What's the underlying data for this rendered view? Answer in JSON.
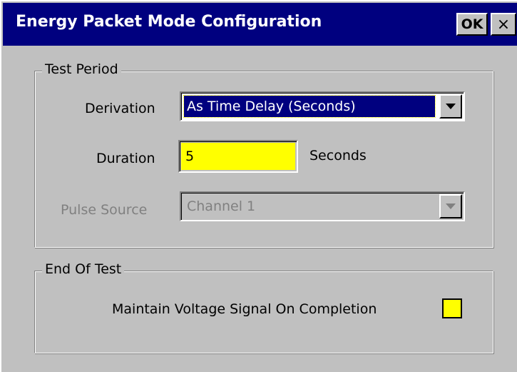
{
  "window": {
    "title": "Energy Packet Mode Configuration",
    "ok_label": "OK",
    "close_label": "×"
  },
  "test_period": {
    "legend": "Test Period",
    "derivation": {
      "label": "Derivation",
      "value": "As Time Delay (Seconds)"
    },
    "duration": {
      "label": "Duration",
      "value": "5",
      "unit": "Seconds"
    },
    "pulse_source": {
      "label": "Pulse Source",
      "value": "Channel 1",
      "enabled": false
    }
  },
  "end_of_test": {
    "legend": "End Of Test",
    "maintain_voltage": {
      "label": "Maintain Voltage Signal On Completion",
      "checked": false
    }
  },
  "colors": {
    "title_bar": "#00007f",
    "face": "#c0c0c0",
    "input_highlight": "#ffff00",
    "selection": "#00007f",
    "disabled_text": "#808080"
  },
  "icons": {
    "dropdown": "chevron-down-icon",
    "close": "close-icon"
  }
}
